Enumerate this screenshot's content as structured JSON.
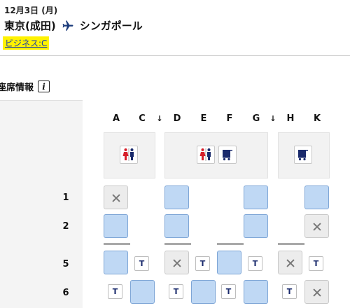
{
  "flight": {
    "date": "12月3日 (月)",
    "origin": "東京(成田)",
    "destination": "シンガポール",
    "cabin": "ビジネス:C"
  },
  "seat_map": {
    "title": "座席情報",
    "info_icon_label": "i",
    "columns": [
      "A",
      "C",
      "D",
      "E",
      "F",
      "G",
      "H",
      "K"
    ],
    "aisle_arrow": "↓",
    "rows": [
      {
        "label": "1",
        "seats": {
          "A": "occupied",
          "C": "none",
          "D": "available",
          "E": "none",
          "F": "none",
          "G": "available",
          "H": "none",
          "K": "available"
        }
      },
      {
        "label": "2",
        "seats": {
          "A": "available",
          "C": "none",
          "D": "available",
          "E": "none",
          "F": "none",
          "G": "available",
          "H": "none",
          "K": "occupied"
        }
      },
      {
        "label": "5",
        "seats": {
          "A": "available",
          "C": "table",
          "D": "occupied",
          "E": "table",
          "F": "available",
          "G": "table",
          "H": "occupied",
          "K": "table"
        }
      },
      {
        "label": "6",
        "seats": {
          "A": "table",
          "C": "available",
          "D": "table",
          "E": "available",
          "F": "table",
          "G": "available",
          "H": "table",
          "K": "occupied"
        }
      }
    ],
    "table_marker": "T",
    "facilities": [
      "lavatory-icon",
      "lavatory-icon",
      "galley-icon",
      "galley-icon"
    ]
  },
  "colors": {
    "available_seat": "#bfd8f4",
    "occupied_seat": "#ececec",
    "cabin_highlight": "#fff200",
    "lavatory_female": "#d6202a",
    "lavatory_male": "#1a2a6c"
  }
}
